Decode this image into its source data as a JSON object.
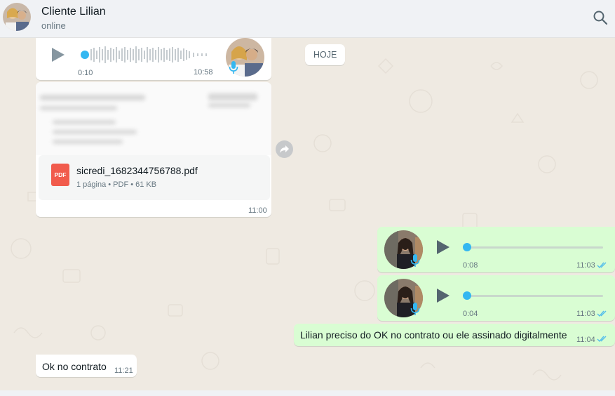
{
  "header": {
    "contact_name": "Cliente Lilian",
    "status": "online"
  },
  "date_chip": "HOJE",
  "messages": [
    {
      "type": "voice",
      "direction": "incoming",
      "duration": "0:10",
      "time": "10:58",
      "progress": 0
    },
    {
      "type": "document",
      "direction": "incoming",
      "file_name": "sicredi_1682344756788.pdf",
      "file_icon_label": "PDF",
      "meta": "1 página • PDF • 61 KB",
      "time": "11:00"
    },
    {
      "type": "voice",
      "direction": "outgoing",
      "duration": "0:08",
      "time": "11:03",
      "read": true,
      "progress": 0
    },
    {
      "type": "voice",
      "direction": "outgoing",
      "duration": "0:04",
      "time": "11:03",
      "read": true,
      "progress": 0
    },
    {
      "type": "text",
      "direction": "outgoing",
      "text": "Lilian preciso do OK no contrato ou ele assinado digitalmente",
      "time": "11:04",
      "read": true
    },
    {
      "type": "text",
      "direction": "incoming",
      "text": "Ok no contrato",
      "time": "11:21"
    }
  ],
  "colors": {
    "wallpaper": "#efeae2",
    "incoming_bubble": "#ffffff",
    "outgoing_bubble": "#d9fdd3",
    "accent_blue": "#34b7f1",
    "read_ticks": "#53bdeb"
  }
}
